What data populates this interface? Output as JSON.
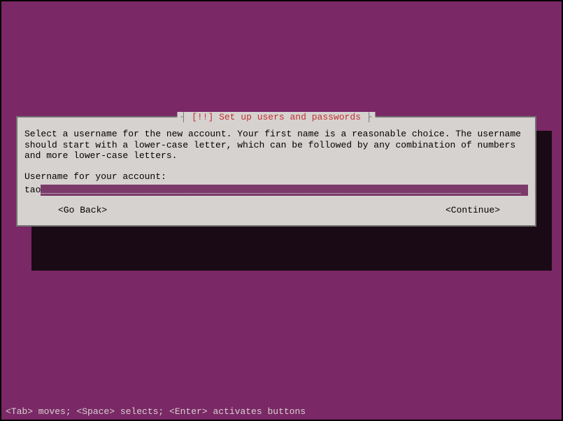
{
  "dialog": {
    "title": "[!!] Set up users and passwords",
    "description": "Select a username for the new account. Your first name is a reasonable choice. The username should start with a lower-case letter, which can be followed by any combination of numbers and more lower-case letters.",
    "prompt": "Username for your account:",
    "input_value": "tao",
    "go_back_label": "<Go Back>",
    "continue_label": "<Continue>"
  },
  "footer": {
    "hint": "<Tab> moves; <Space> selects; <Enter> activates buttons"
  }
}
